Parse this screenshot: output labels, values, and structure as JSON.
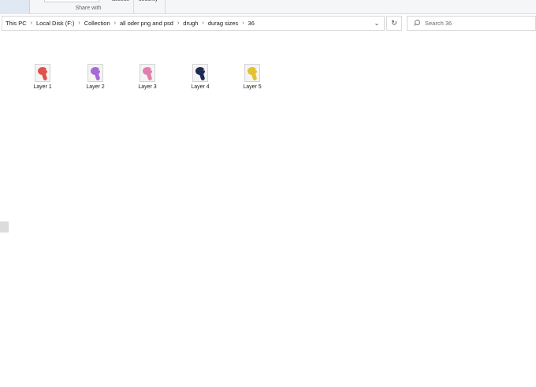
{
  "ribbon": {
    "group_label": "Share with",
    "fragment_access": "access",
    "fragment_security": "security"
  },
  "breadcrumb": [
    {
      "label": "This PC"
    },
    {
      "label": "Local Disk (F:)"
    },
    {
      "label": "Collection"
    },
    {
      "label": "all oder png and psd"
    },
    {
      "label": "drugh"
    },
    {
      "label": "durag sizes"
    },
    {
      "label": "36"
    }
  ],
  "search": {
    "placeholder": "Search 36"
  },
  "icons": {
    "breadcrumb_separator": "chevron-right-icon",
    "address_dropdown": "chevron-down-icon",
    "refresh": "refresh-icon",
    "search": "search-icon"
  },
  "files": [
    {
      "name": "Layer 1",
      "color": "#e0504f"
    },
    {
      "name": "Layer 2",
      "color": "#a56ad8"
    },
    {
      "name": "Layer 3",
      "color": "#e07fae"
    },
    {
      "name": "Layer 4",
      "color": "#1e2a55"
    },
    {
      "name": "Layer 5",
      "color": "#e2c22e"
    }
  ]
}
